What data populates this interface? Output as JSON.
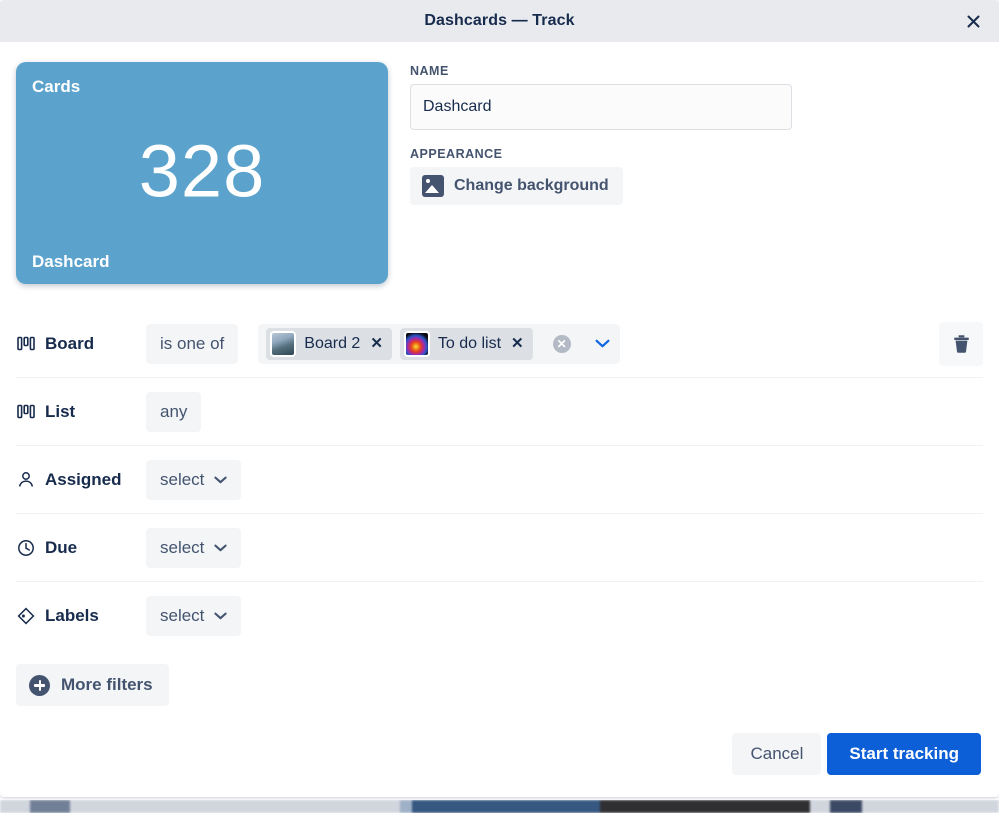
{
  "window": {
    "title": "Dashcards — Track",
    "close_icon": "close-icon"
  },
  "preview": {
    "top_label": "Cards",
    "value": "328",
    "bottom_label": "Dashcard",
    "background_color": "#5ba3cc"
  },
  "form": {
    "name_label": "NAME",
    "name_value": "Dashcard",
    "name_placeholder": "Dashcard",
    "appearance_label": "APPEARANCE",
    "change_background_label": "Change background",
    "change_background_icon": "image-icon"
  },
  "filters": {
    "rows": [
      {
        "icon": "board-icon",
        "label": "Board",
        "operator": "is one of",
        "chips": [
          {
            "label": "Board 2",
            "remove_icon": "close-icon",
            "thumb": "thumb-board2"
          },
          {
            "label": "To do list",
            "remove_icon": "close-icon",
            "thumb": "thumb-todo"
          }
        ],
        "clear_icon": "clear-circle-icon",
        "chevron_icon": "chevron-down-icon",
        "delete_icon": "trash-icon"
      },
      {
        "icon": "board-icon",
        "label": "List",
        "value": "any"
      },
      {
        "icon": "person-icon",
        "label": "Assigned",
        "value": "select",
        "chevron_icon": "chevron-down-icon"
      },
      {
        "icon": "clock-icon",
        "label": "Due",
        "value": "select",
        "chevron_icon": "chevron-down-icon"
      },
      {
        "icon": "label-icon",
        "label": "Labels",
        "value": "select",
        "chevron_icon": "chevron-down-icon"
      }
    ],
    "more_filters_label": "More filters",
    "more_filters_icon": "plus-circle-icon"
  },
  "footer": {
    "cancel_label": "Cancel",
    "submit_label": "Start tracking",
    "submit_color": "#0c5fd6"
  }
}
